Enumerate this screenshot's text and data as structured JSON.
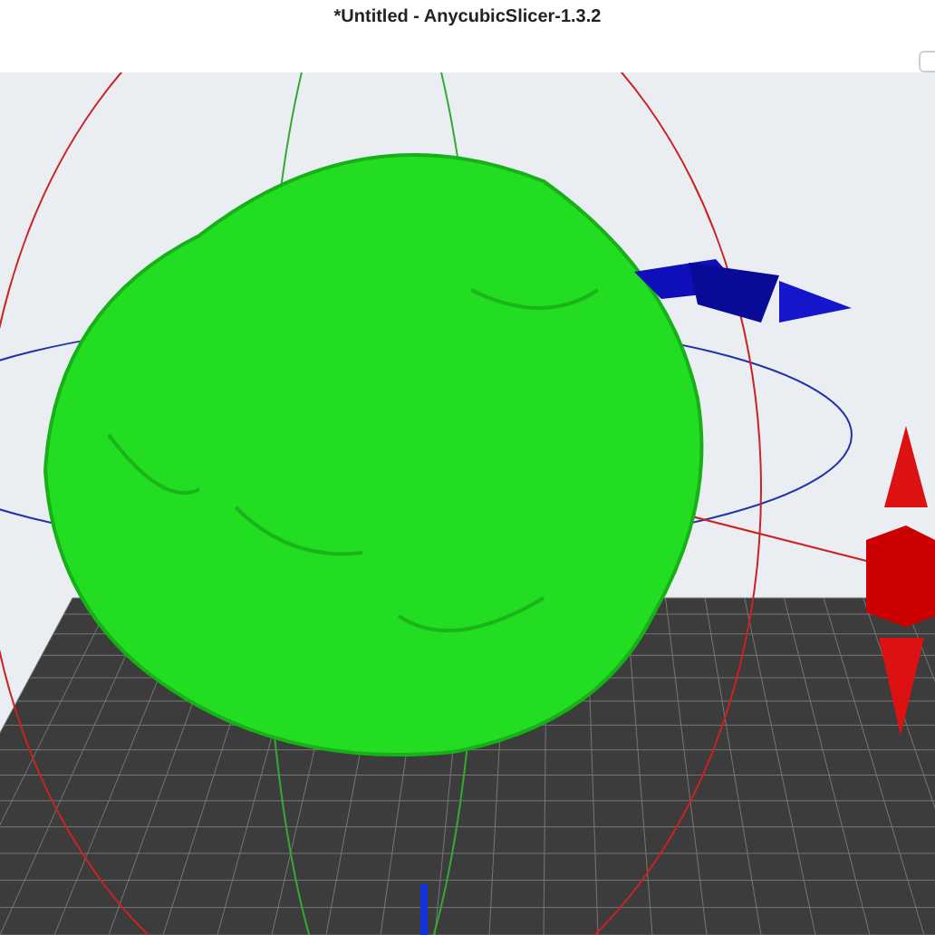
{
  "window": {
    "title": "*Untitled - AnycubicSlicer-1.3.2"
  }
}
